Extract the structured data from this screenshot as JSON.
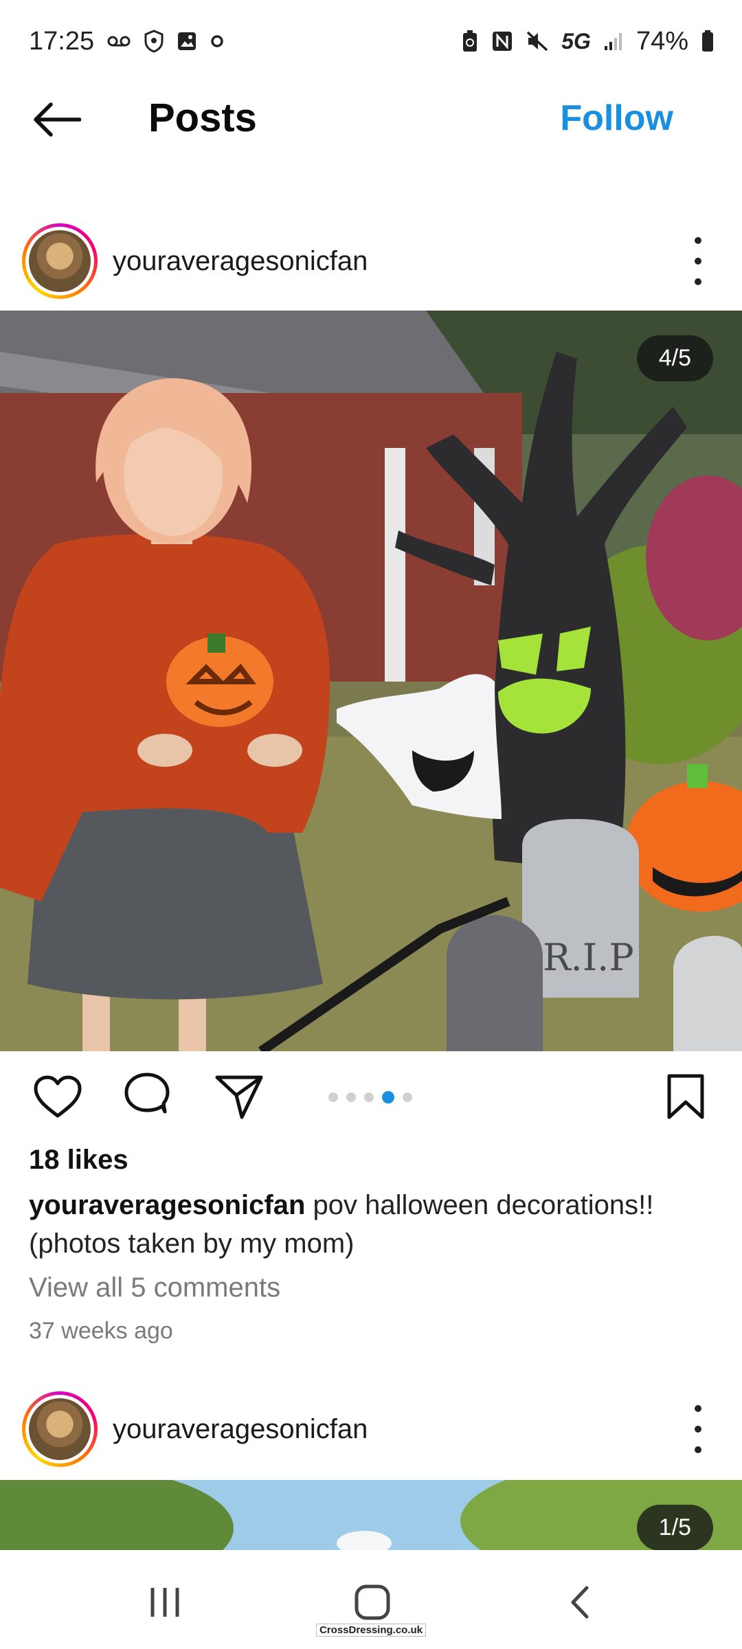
{
  "status_bar": {
    "time": "17:25",
    "battery": "74%",
    "network": "5G",
    "left_icons": [
      "voicemail-icon",
      "shield-icon",
      "gallery-icon",
      "circle-icon"
    ],
    "right_icons": [
      "battery-saver-icon",
      "nfc-icon",
      "mute-icon",
      "5g-icon",
      "signal-icon",
      "battery-icon"
    ]
  },
  "top_bar": {
    "back_icon": "arrow-left-icon",
    "title": "Posts",
    "follow_label": "Follow"
  },
  "post": {
    "username": "youraveragesonicfan",
    "image_counter": "4/5",
    "carousel_total": 5,
    "carousel_active": 4,
    "likes": "18 likes",
    "caption_user": "youraveragesonicfan",
    "caption_text": "pov halloween decorations!! (photos taken by my mom)",
    "view_comments": "View all 5 comments",
    "time_ago": "37 weeks ago"
  },
  "next_post": {
    "username": "youraveragesonicfan",
    "image_counter": "1/5"
  },
  "nav_bar": {
    "recent_icon": "recent-apps-icon",
    "home_icon": "home-icon",
    "back_icon": "back-chevron-icon"
  },
  "watermark": "CrossDressing.co.uk",
  "colors": {
    "accent": "#1a8fe0",
    "text_primary": "#111111",
    "text_secondary": "#7a7a7a"
  }
}
